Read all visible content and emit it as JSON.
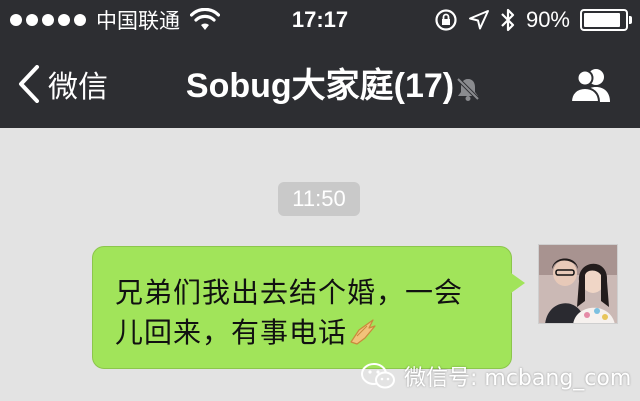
{
  "status_bar": {
    "carrier": "中国联通",
    "time": "17:17",
    "battery_percent": "90%",
    "battery_level": 0.9,
    "signal_bars": 5
  },
  "nav": {
    "back_label": "微信",
    "title": "Sobug大家庭(17)"
  },
  "chat": {
    "timestamp": "11:50",
    "message": "兄弟们我出去结个婚，一会儿回来，有事电话"
  },
  "watermark": {
    "text": "微信号: mcbang_com"
  },
  "colors": {
    "bar_bg": "#2d2e32",
    "chat_bg": "#e3e3e3",
    "bubble": "#a1e45a",
    "timestamp_bg": "#c9c9c9"
  },
  "icons": [
    "wifi-icon",
    "lock-rotation-icon",
    "location-icon",
    "bluetooth-icon",
    "battery-icon",
    "back-chevron-icon",
    "mute-bell-icon",
    "members-icon",
    "hand-emoji-icon",
    "wechat-logo-icon"
  ]
}
